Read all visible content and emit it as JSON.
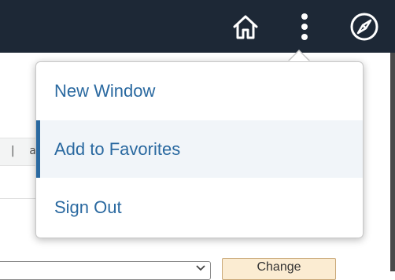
{
  "header": {
    "icons": {
      "home": "home-icon",
      "more": "more-options-icon",
      "navigator": "compass-icon"
    },
    "colors": {
      "bar": "#1d2836",
      "icon": "#ffffff"
    }
  },
  "actions_menu": {
    "items": [
      {
        "label": "New Window"
      },
      {
        "label": "Add to Favorites",
        "highlighted": true
      },
      {
        "label": "Sign Out"
      }
    ],
    "colors": {
      "text": "#2a69a0",
      "highlight": "#f1f5f9"
    }
  },
  "background_page": {
    "fragment_text": "|  a",
    "button_label": "Change"
  }
}
